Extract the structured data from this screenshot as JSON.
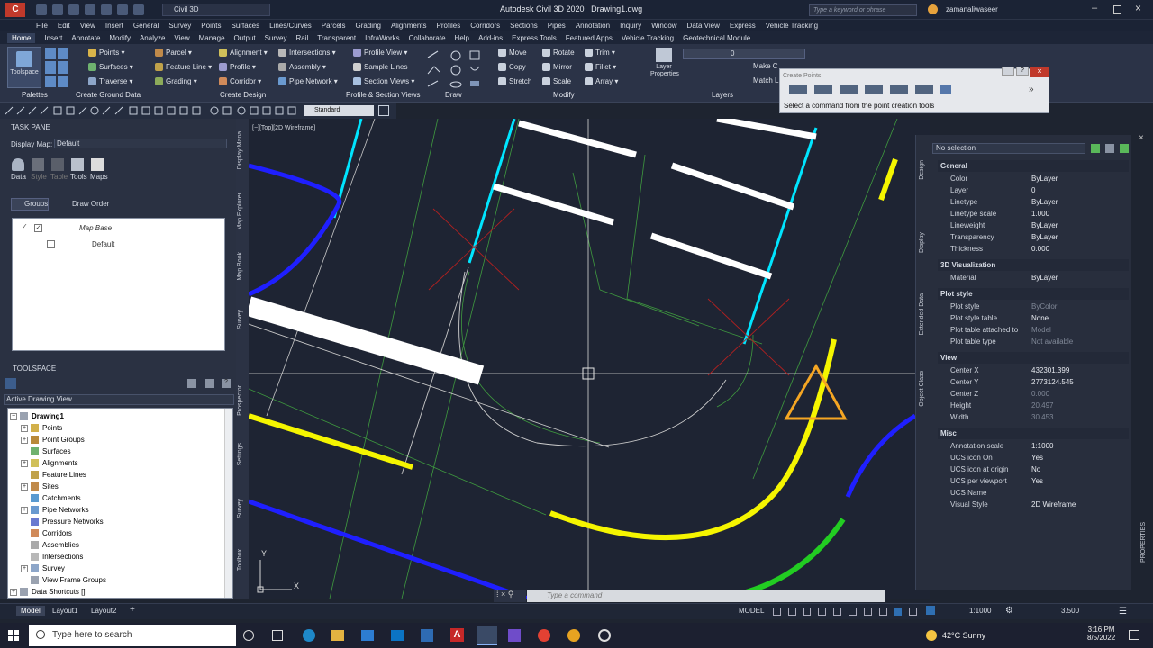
{
  "app": {
    "title": "Autodesk Civil 3D 2020",
    "file": "Drawing1.dwg",
    "workspace": "Civil 3D",
    "search_placeholder": "Type a keyword or phrase",
    "user": "zamanaliwaseer"
  },
  "menu": [
    "File",
    "Edit",
    "View",
    "Insert",
    "General",
    "Survey",
    "Points",
    "Surfaces",
    "Lines/Curves",
    "Parcels",
    "Grading",
    "Alignments",
    "Profiles",
    "Corridors",
    "Sections",
    "Pipes",
    "Annotation",
    "Inquiry",
    "Window",
    "Data View",
    "Express",
    "Vehicle Tracking"
  ],
  "ribbon_tabs": [
    "Home",
    "Insert",
    "Annotate",
    "Modify",
    "Analyze",
    "View",
    "Manage",
    "Output",
    "Survey",
    "Rail",
    "Transparent",
    "InfraWorks",
    "Collaborate",
    "Help",
    "Add-ins",
    "Express Tools",
    "Featured Apps",
    "Vehicle Tracking",
    "Geotechnical Module"
  ],
  "ribbon": {
    "toolspace": "Toolspace",
    "palettes": "Palettes",
    "ground": [
      "Points",
      "Surfaces",
      "Traverse"
    ],
    "ground_label": "Create Ground Data",
    "design": [
      "Parcel",
      "Feature Line",
      "Grading",
      "Alignment",
      "Profile",
      "Corridor",
      "Intersections",
      "Assembly",
      "Pipe Network"
    ],
    "design_label": "Create Design",
    "views": [
      "Profile View",
      "Sample Lines",
      "Section Views"
    ],
    "views_label": "Profile & Section Views",
    "draw_label": "Draw",
    "modify": [
      "Move",
      "Copy",
      "Stretch",
      "Rotate",
      "Mirror",
      "Scale",
      "Trim",
      "Fillet",
      "Array"
    ],
    "modify_label": "Modify",
    "layer_props": "Layer Properties",
    "layers_label": "Layers",
    "layer_value": "0",
    "make_current": "Make C",
    "match": "Match L"
  },
  "toolbar2": {
    "style": "Standard"
  },
  "create_points": {
    "title": "Create Points",
    "hint": "Select a command from the point creation tools"
  },
  "taskpane": {
    "title": "TASK PANE",
    "display_map_label": "Display Map:",
    "display_map_value": "Default",
    "tools": [
      "Data",
      "Style",
      "Table",
      "Tools",
      "Maps"
    ],
    "groups": "Groups",
    "draw_order": "Draw Order",
    "map_base": "Map Base",
    "default": "Default"
  },
  "side_tabs": [
    "Display Mana...",
    "Map Explorer",
    "Map Book",
    "Survey",
    "Prospector",
    "Settings",
    "Survey",
    "Toolbox"
  ],
  "toolspace": {
    "title": "TOOLSPACE",
    "view": "Active Drawing View",
    "root": "Drawing1",
    "items": [
      "Points",
      "Point Groups",
      "Surfaces",
      "Alignments",
      "Feature Lines",
      "Sites",
      "Catchments",
      "Pipe Networks",
      "Pressure Networks",
      "Corridors",
      "Assemblies",
      "Intersections",
      "Survey",
      "View Frame Groups"
    ],
    "shortcuts": "Data Shortcuts []"
  },
  "viewport_label": "[−][Top][2D Wireframe]",
  "props": {
    "selection": "No selection",
    "side_tabs": [
      "Design",
      "Display",
      "Extended Data",
      "Object Class"
    ],
    "sections": [
      {
        "name": "General",
        "rows": [
          [
            "Color",
            "ByLayer"
          ],
          [
            "Layer",
            "0"
          ],
          [
            "Linetype",
            "ByLayer"
          ],
          [
            "Linetype scale",
            "1.000"
          ],
          [
            "Lineweight",
            "ByLayer"
          ],
          [
            "Transparency",
            "ByLayer"
          ],
          [
            "Thickness",
            "0.000"
          ]
        ]
      },
      {
        "name": "3D Visualization",
        "rows": [
          [
            "Material",
            "ByLayer"
          ]
        ]
      },
      {
        "name": "Plot style",
        "rows": [
          [
            "Plot style",
            "ByColor"
          ],
          [
            "Plot style table",
            "None"
          ],
          [
            "Plot table attached to",
            "Model"
          ],
          [
            "Plot table type",
            "Not available"
          ]
        ]
      },
      {
        "name": "View",
        "rows": [
          [
            "Center X",
            "432301.399"
          ],
          [
            "Center Y",
            "2773124.545"
          ],
          [
            "Center Z",
            "0.000"
          ],
          [
            "Height",
            "20.497"
          ],
          [
            "Width",
            "30.453"
          ]
        ]
      },
      {
        "name": "Misc",
        "rows": [
          [
            "Annotation scale",
            "1:1000"
          ],
          [
            "UCS icon On",
            "Yes"
          ],
          [
            "UCS icon at origin",
            "No"
          ],
          [
            "UCS per viewport",
            "Yes"
          ],
          [
            "UCS Name",
            ""
          ],
          [
            "Visual Style",
            "2D Wireframe"
          ]
        ]
      }
    ],
    "properties_tab": "PROPERTIES"
  },
  "cmdline": {
    "placeholder": "Type a command"
  },
  "layout_tabs": [
    "Model",
    "Layout1",
    "Layout2"
  ],
  "status": {
    "model": "MODEL",
    "scale": "1:1000",
    "value": "3.500"
  },
  "taskbar": {
    "search": "Type here to search",
    "weather": "42°C Sunny",
    "time": "3:16 PM",
    "date": "8/5/2022"
  },
  "ucs": {
    "x": "X",
    "y": "Y"
  }
}
